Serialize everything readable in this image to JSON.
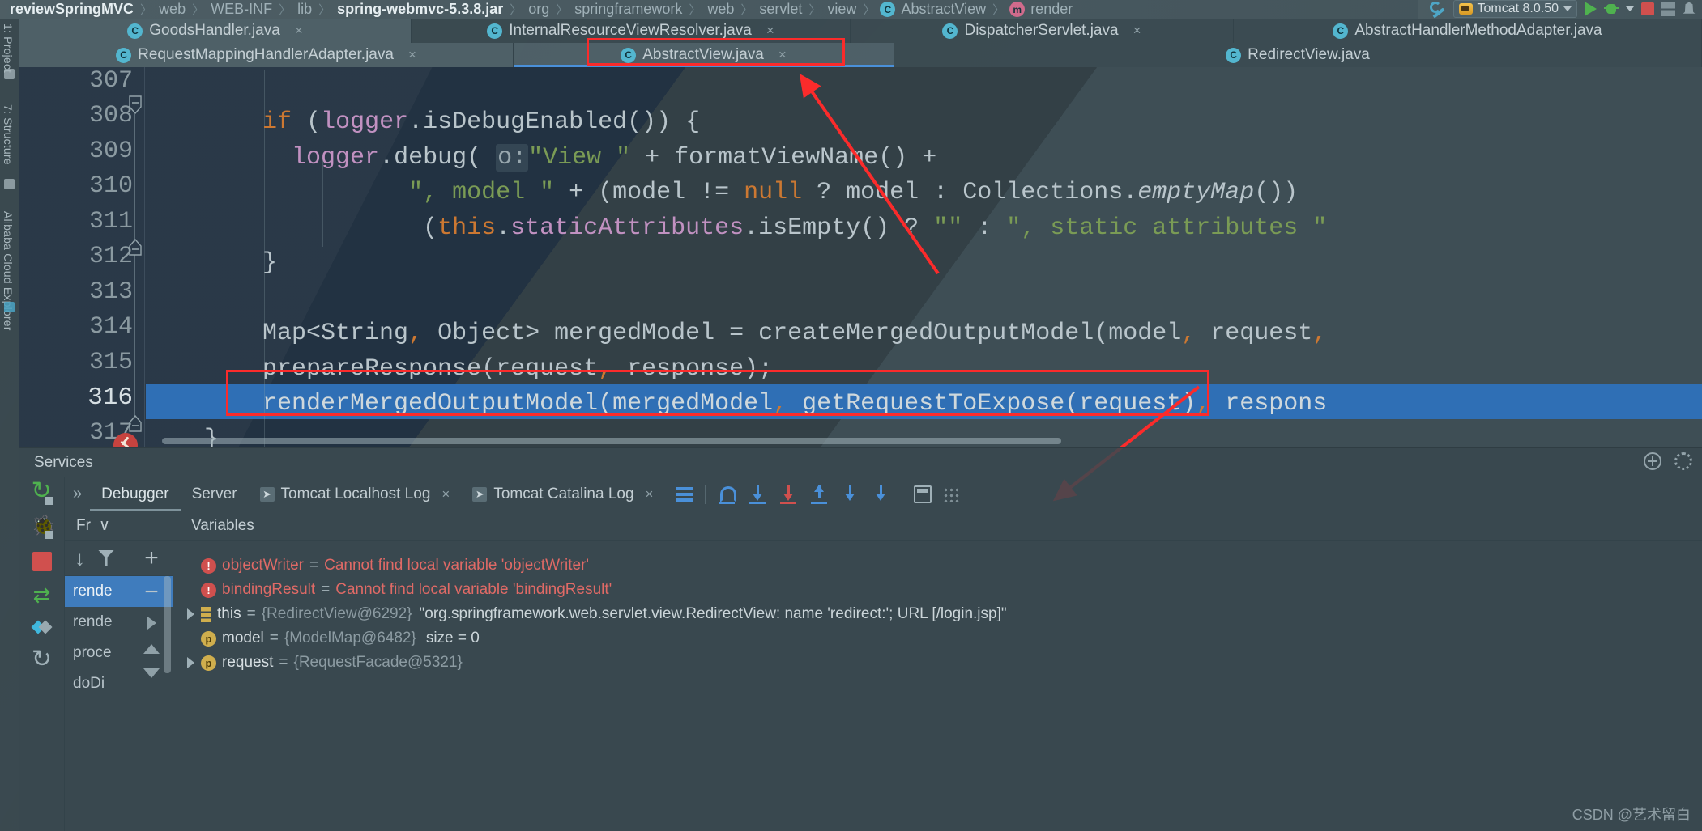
{
  "breadcrumb": [
    {
      "text": "reviewSpringMVC",
      "bold": true,
      "icon": ""
    },
    {
      "text": "web",
      "bold": false,
      "icon": ""
    },
    {
      "text": "WEB-INF",
      "bold": false,
      "icon": ""
    },
    {
      "text": "lib",
      "bold": false,
      "icon": ""
    },
    {
      "text": "spring-webmvc-5.3.8.jar",
      "bold": true,
      "icon": ""
    },
    {
      "text": "org",
      "bold": false,
      "icon": ""
    },
    {
      "text": "springframework",
      "bold": false,
      "icon": ""
    },
    {
      "text": "web",
      "bold": false,
      "icon": ""
    },
    {
      "text": "servlet",
      "bold": false,
      "icon": ""
    },
    {
      "text": "view",
      "bold": false,
      "icon": ""
    },
    {
      "text": "AbstractView",
      "bold": false,
      "icon": "class-icon"
    },
    {
      "text": "render",
      "bold": false,
      "icon": "method-icon"
    }
  ],
  "run_toolbar": {
    "wrench_icon": "wrench-icon",
    "config_name": "Tomcat 8.0.50",
    "run_icon": "run-icon",
    "debug_icon": "debug-icon",
    "stop_icon": "stop-icon",
    "grid_icon": "layout-icon",
    "bell_icon": "notifications-icon"
  },
  "left_rail": {
    "project_label": "1: Project",
    "structure_label": "7: Structure",
    "cloud_label": "Alibaba Cloud Explorer"
  },
  "editor_tabs": {
    "row1": [
      {
        "label": "GoodsHandler.java",
        "icon": "class-icon",
        "closable": true,
        "state": "selected"
      },
      {
        "label": "InternalResourceViewResolver.java",
        "icon": "class-icon",
        "closable": true,
        "state": "normal"
      },
      {
        "label": "DispatcherServlet.java",
        "icon": "class-icon",
        "closable": true,
        "state": "normal"
      },
      {
        "label": "AbstractHandlerMethodAdapter.java",
        "icon": "class-icon",
        "closable": false,
        "state": "normal"
      }
    ],
    "row2": [
      {
        "label": "RequestMappingHandlerAdapter.java",
        "icon": "class-icon",
        "closable": true,
        "state": "normal"
      },
      {
        "label": "AbstractView.java",
        "icon": "class-icon",
        "closable": true,
        "state": "active"
      },
      {
        "label": "RedirectView.java",
        "icon": "class-icon",
        "closable": false,
        "state": "normal"
      }
    ],
    "close_glyph": "×"
  },
  "editor": {
    "line_numbers": [
      "307",
      "308",
      "309",
      "310",
      "311",
      "312",
      "313",
      "314",
      "315",
      "316",
      "317"
    ],
    "current_line": "316",
    "breakpoint_hit_icon": "breakpoint-hit-icon",
    "lines": [
      {
        "no": "307",
        "text": ""
      },
      {
        "no": "308",
        "text": "        if (logger.isDebugEnabled()) {"
      },
      {
        "no": "309",
        "text": "            logger.debug( o:\"View \" + formatViewName() +"
      },
      {
        "no": "310",
        "text": "                    \", model \" + (model != null ? model : Collections.emptyMap()) +"
      },
      {
        "no": "311",
        "text": "                    (this.staticAttributes.isEmpty() ? \"\" : \", static attributes \""
      },
      {
        "no": "312",
        "text": "        }"
      },
      {
        "no": "313",
        "text": ""
      },
      {
        "no": "314",
        "text": "        Map<String, Object> mergedModel = createMergedOutputModel(model, request,"
      },
      {
        "no": "315",
        "text": "        prepareResponse(request, response);"
      },
      {
        "no": "316",
        "text": "        renderMergedOutputModel(mergedModel, getRequestToExpose(request), respons"
      },
      {
        "no": "317",
        "text": "    }"
      }
    ],
    "parameter_hint": "o:",
    "colors": {
      "keyword": "#cc7832",
      "string": "#7a9b55",
      "field": "#c191c1",
      "plain": "#b9c5cb",
      "selection": "#2f6fb5",
      "annotation_red": "#fb2b2b"
    }
  },
  "annotations": {
    "tab_box_target": "AbstractView.java",
    "code_box_target": "renderMergedOutputModel(mergedModel, getRequestToExpose(request), respons",
    "arrow_count": 2
  },
  "services": {
    "title": "Services",
    "header_icons": [
      "help-icon",
      "settings-icon"
    ],
    "rail_icons": [
      "rerun-icon",
      "debug-icon",
      "stop-icon",
      "thread-dump-icon",
      "layout-icon",
      "refresh-icon"
    ],
    "expand_chevron": "»",
    "tabs": [
      {
        "label": "Debugger",
        "icon": "",
        "closable": false,
        "active": true
      },
      {
        "label": "Server",
        "icon": "",
        "closable": false,
        "active": false
      },
      {
        "label": "Tomcat Localhost Log",
        "icon": "console-icon",
        "closable": true,
        "active": false
      },
      {
        "label": "Tomcat Catalina Log",
        "icon": "console-icon",
        "closable": true,
        "active": false
      }
    ],
    "tools": [
      "mute-breakpoints-icon",
      "step-over-icon",
      "step-into-icon",
      "force-step-into-icon",
      "step-out-icon",
      "drop-frame-icon",
      "run-to-cursor-icon",
      "evaluate-expression-icon",
      "settings-dots-icon"
    ],
    "frames": {
      "header_label": "Fr",
      "header_chevron": "∨",
      "toolbar_icons": [
        "jump-icon",
        "filter-icon"
      ],
      "items": [
        {
          "label": "rende",
          "selected": true
        },
        {
          "label": "rende",
          "selected": false
        },
        {
          "label": "proce",
          "selected": false
        },
        {
          "label": "doDi",
          "selected": false
        }
      ]
    },
    "variables": {
      "header_label": "Variables",
      "side_icons": [
        "add-icon",
        "remove-icon",
        "move-right-icon",
        "move-up-icon",
        "move-down-icon"
      ],
      "rows": [
        {
          "expandable": false,
          "icon": "error-icon",
          "name": "objectWriter",
          "eq": "=",
          "message": "Cannot find local variable 'objectWriter'",
          "ref": "",
          "value": "",
          "size": ""
        },
        {
          "expandable": false,
          "icon": "error-icon",
          "name": "bindingResult",
          "eq": "=",
          "message": "Cannot find local variable 'bindingResult'",
          "ref": "",
          "value": "",
          "size": ""
        },
        {
          "expandable": true,
          "icon": "object-icon",
          "name": "this",
          "eq": "=",
          "message": "",
          "ref": "{RedirectView@6292}",
          "value": "\"org.springframework.web.servlet.view.RedirectView: name 'redirect:'; URL [/login.jsp]\"",
          "size": ""
        },
        {
          "expandable": false,
          "icon": "param-icon",
          "name": "model",
          "eq": "=",
          "message": "",
          "ref": "{ModelMap@6482}",
          "value": "",
          "size": "size = 0"
        },
        {
          "expandable": true,
          "icon": "param-icon",
          "name": "request",
          "eq": "=",
          "message": "",
          "ref": "{RequestFacade@5321}",
          "value": "",
          "size": ""
        }
      ]
    }
  },
  "watermark": "CSDN @艺术留白"
}
